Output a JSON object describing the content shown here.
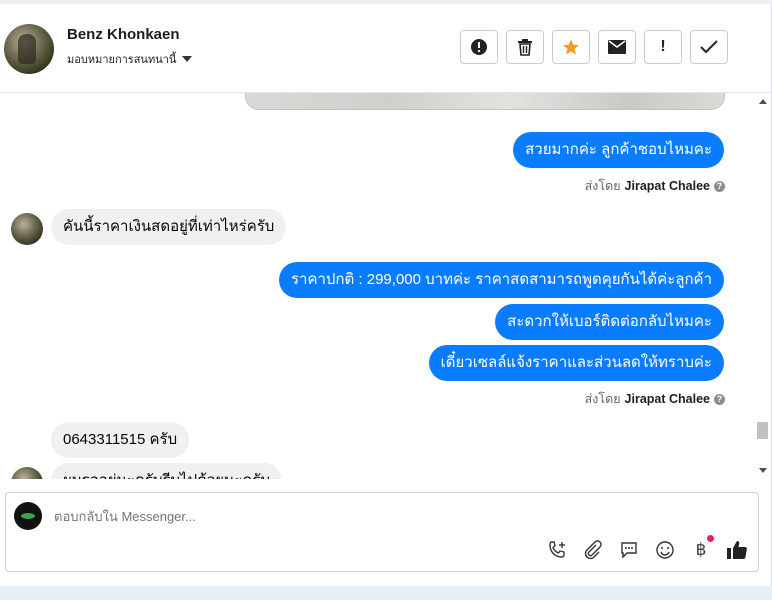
{
  "contact": {
    "name": "Benz Khonkaen",
    "assign_label": "มอบหมายการสนทนานี้"
  },
  "toolbar": [
    {
      "name": "alert-icon-button",
      "icon": "exclamation-circle-icon"
    },
    {
      "name": "delete-button",
      "icon": "trash-icon"
    },
    {
      "name": "star-button",
      "icon": "star-icon"
    },
    {
      "name": "mark-unread-button",
      "icon": "envelope-icon"
    },
    {
      "name": "important-button",
      "label": "!"
    },
    {
      "name": "done-button",
      "icon": "check-icon"
    }
  ],
  "messages": {
    "out1": "สวยมากค่ะ ลูกค้าชอบไหมคะ",
    "sent_by_prefix": "ส่งโดย",
    "sent_by_name": "Jirapat Chalee",
    "in1": "คันนี้ราคาเงินสดอยู่ที่เท่าไหร่ครับ",
    "out2": "ราคาปกติ : 299,000 บาทค่ะ  ราคาสดสามารถพูดคุยกันได้ค่ะลูกค้า",
    "out3": "สะดวกให้เบอร์ติดต่อกลับไหมคะ",
    "out4": "เดี๋ยวเซลล์แจ้งราคาและส่วนลดให้ทราบค่ะ",
    "in2": "0643311515 ครับ",
    "in3_partial": "ผมรออยู่นะครับรีบไปด้วยนะครับ"
  },
  "composer": {
    "placeholder": "ตอบกลับใน Messenger...",
    "tools": [
      "call-plus-icon",
      "paperclip-icon",
      "chat-bubble-icon",
      "smile-icon",
      "baht-icon",
      "thumbs-up-icon"
    ],
    "baht_symbol": "฿"
  },
  "colors": {
    "outgoing_bubble": "#0a7cff",
    "incoming_bubble": "#f0f0f0",
    "star": "#f59b23"
  }
}
